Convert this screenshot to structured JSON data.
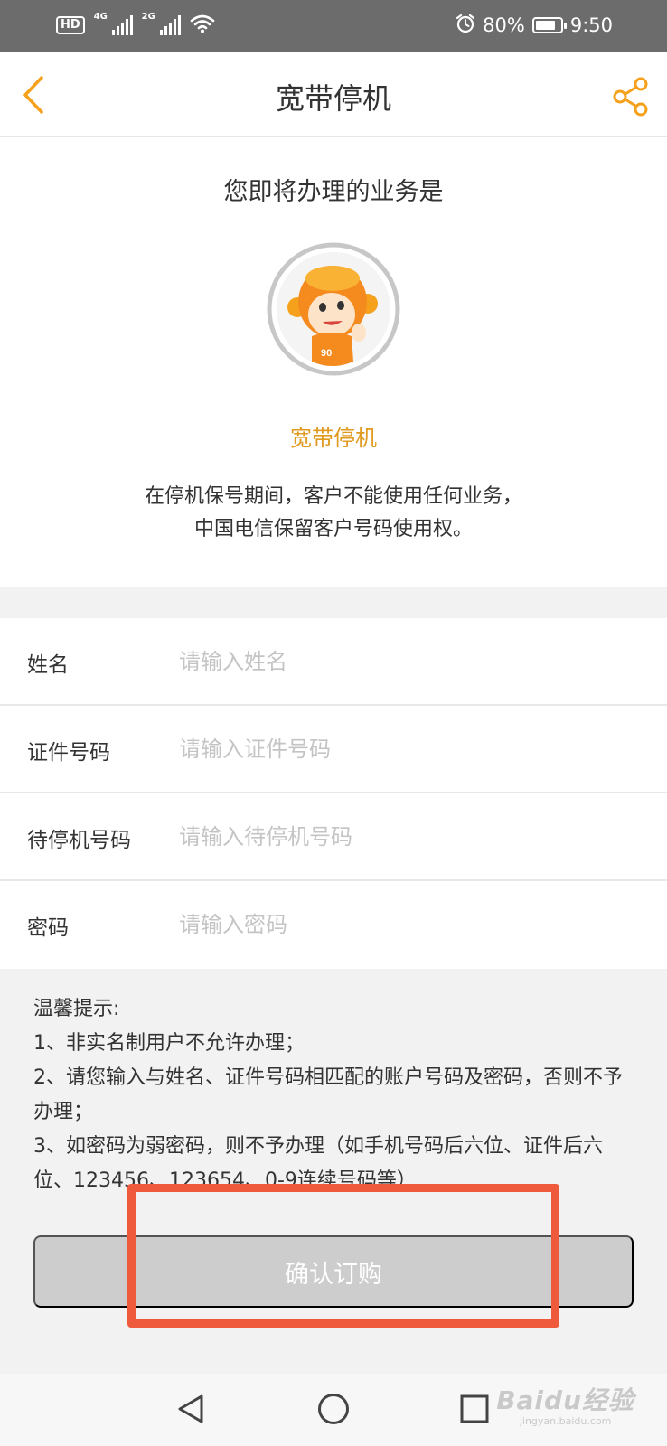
{
  "status_bar": {
    "hd": "HD",
    "sim1": "4G",
    "sim2": "2G",
    "battery_percent": "80%",
    "battery_level": 0.8,
    "time": "9:50"
  },
  "header": {
    "title": "宽带停机",
    "back_icon": "chevron-left-icon",
    "share_icon": "share-icon"
  },
  "intro": {
    "heading": "您即将办理的业务是",
    "service_name": "宽带停机",
    "description_line1": "在停机保号期间，客户不能使用任何业务，",
    "description_line2": "中国电信保留客户号码使用权。",
    "mascot_badge": "90"
  },
  "form": {
    "fields": [
      {
        "label": "姓名",
        "placeholder": "请输入姓名",
        "value": ""
      },
      {
        "label": "证件号码",
        "placeholder": "请输入证件号码",
        "value": ""
      },
      {
        "label": "待停机号码",
        "placeholder": "请输入待停机号码",
        "value": ""
      },
      {
        "label": "密码",
        "placeholder": "请输入密码",
        "value": ""
      }
    ]
  },
  "tips": {
    "title": "温馨提示:",
    "items": [
      "1、非实名制用户不允许办理；",
      "2、请您输入与姓名、证件号码相匹配的账户号码及密码，否则不予办理；",
      "3、如密码为弱密码，则不予办理（如手机号码后六位、证件后六位、123456、123654、0-9连续号码等）"
    ]
  },
  "actions": {
    "confirm_label": "确认订购"
  },
  "colors": {
    "accent": "#F5A11C",
    "service_name": "#E09A1F",
    "button_disabled": "#CDCDCD",
    "highlight": "#F05A3C"
  },
  "nav_bar": {
    "back_icon": "triangle-back-icon",
    "home_icon": "circle-home-icon",
    "recents_icon": "square-recents-icon"
  },
  "watermark": {
    "brand": "Baidu经验",
    "url": "jingyan.baidu.com"
  }
}
